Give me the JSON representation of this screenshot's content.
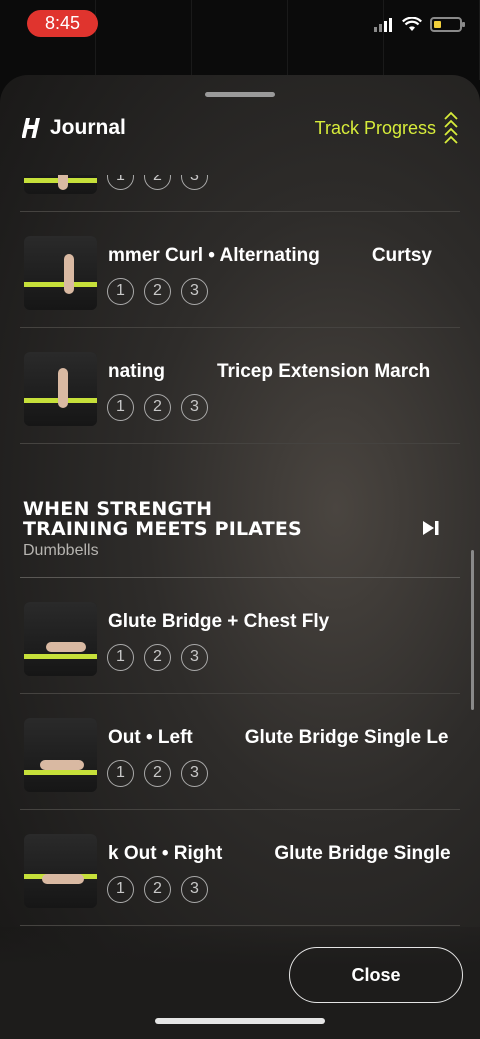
{
  "status": {
    "time": "8:45",
    "battery_level": 0.3
  },
  "header": {
    "title": "Journal",
    "track_progress": "Track Progress"
  },
  "exercises_top": [
    {
      "titles": [
        "",
        ""
      ],
      "partial": true
    },
    {
      "titles": [
        "mmer Curl • Alternating",
        "Curtsy"
      ]
    },
    {
      "titles": [
        "nating",
        "Tricep Extension March"
      ]
    }
  ],
  "section": {
    "title_line1": "WHEN STRENGTH",
    "title_line2": "TRAINING MEETS PILATES",
    "subtitle": "Dumbbells"
  },
  "exercises_bottom": [
    {
      "titles": [
        "Glute Bridge + Chest Fly",
        ""
      ]
    },
    {
      "titles": [
        "Out • Left",
        "Glute Bridge Single Le"
      ]
    },
    {
      "titles": [
        "k Out • Right",
        "Glute Bridge Single"
      ]
    }
  ],
  "sets": [
    "1",
    "2",
    "3"
  ],
  "footer": {
    "close_label": "Close"
  },
  "colors": {
    "accent": "#d7ec3a",
    "status_red": "#e0342e"
  }
}
